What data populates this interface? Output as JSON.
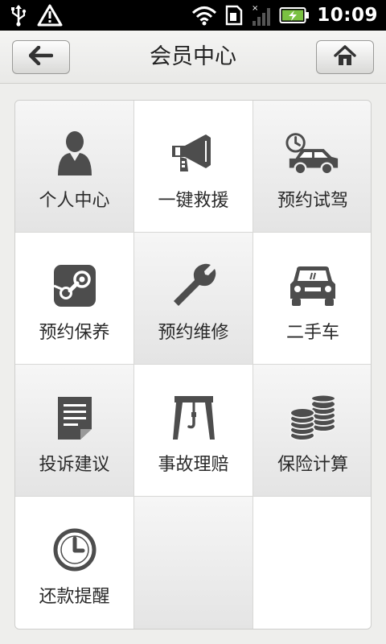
{
  "status_bar": {
    "time": "10:09",
    "icons": [
      "usb-icon",
      "warning-icon",
      "wifi-icon",
      "sim-card-icon",
      "signal-icon",
      "battery-charging-icon"
    ]
  },
  "header": {
    "title": "会员中心",
    "back_icon": "arrow-left-icon",
    "home_icon": "home-icon"
  },
  "colors": {
    "icon": "#4d4d4d",
    "status_bg": "#000000",
    "battery_green": "#7ac142"
  },
  "grid": {
    "items": [
      {
        "label": "个人中心",
        "icon": "person-icon"
      },
      {
        "label": "一键救援",
        "icon": "megaphone-icon"
      },
      {
        "label": "预约试驾",
        "icon": "car-clock-icon"
      },
      {
        "label": "预约保养",
        "icon": "steam-icon"
      },
      {
        "label": "预约维修",
        "icon": "wrench-icon"
      },
      {
        "label": "二手车",
        "icon": "car-front-icon"
      },
      {
        "label": "投诉建议",
        "icon": "document-icon"
      },
      {
        "label": "事故理赔",
        "icon": "tow-crane-icon"
      },
      {
        "label": "保险计算",
        "icon": "coins-icon"
      },
      {
        "label": "还款提醒",
        "icon": "clock-icon"
      }
    ]
  }
}
